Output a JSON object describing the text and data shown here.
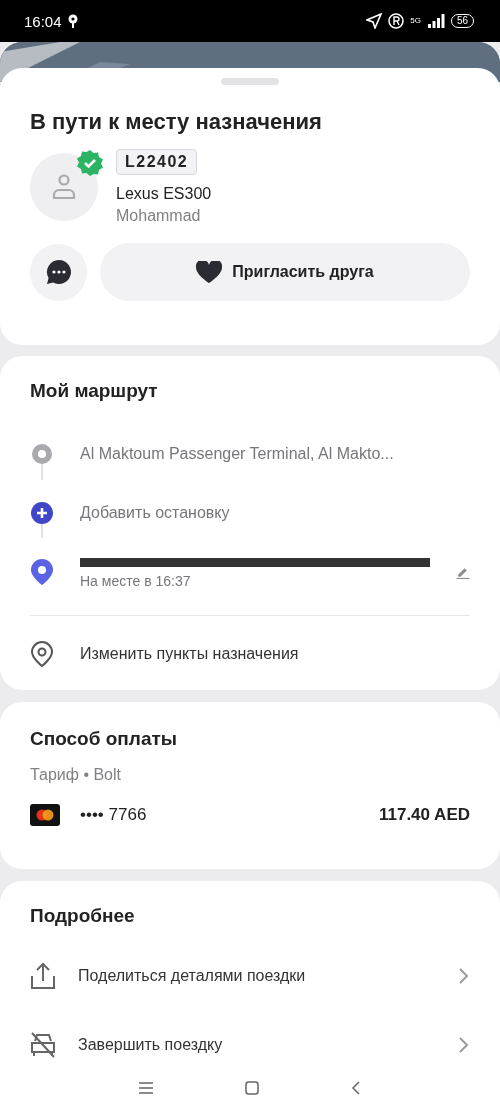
{
  "status_bar": {
    "time": "16:04",
    "battery": "56",
    "network": "5G"
  },
  "trip": {
    "title": "В пути к месту назначения",
    "driver_verified": true,
    "plate": "L22402",
    "car": "Lexus ES300",
    "driver": "Mohammad",
    "invite_button": "Пригласить друга"
  },
  "route": {
    "title": "Мой маршрут",
    "stops": [
      {
        "kind": "pickup",
        "text": "Al Maktoum Passenger Terminal,  Al Makto..."
      },
      {
        "kind": "add",
        "text": "Добавить остановку"
      },
      {
        "kind": "destination",
        "subtext": "На месте в 16:37",
        "redacted": true
      }
    ],
    "change_destinations": "Изменить пункты назначения"
  },
  "payment": {
    "title": "Способ оплаты",
    "tariff": "Тариф • Bolt",
    "card": "•••• 7766",
    "price": "117.40 AED"
  },
  "details": {
    "title": "Подробнее",
    "items": [
      {
        "kind": "share",
        "label": "Поделиться деталями поездки"
      },
      {
        "kind": "end",
        "label": "Завершить поездку"
      }
    ]
  }
}
